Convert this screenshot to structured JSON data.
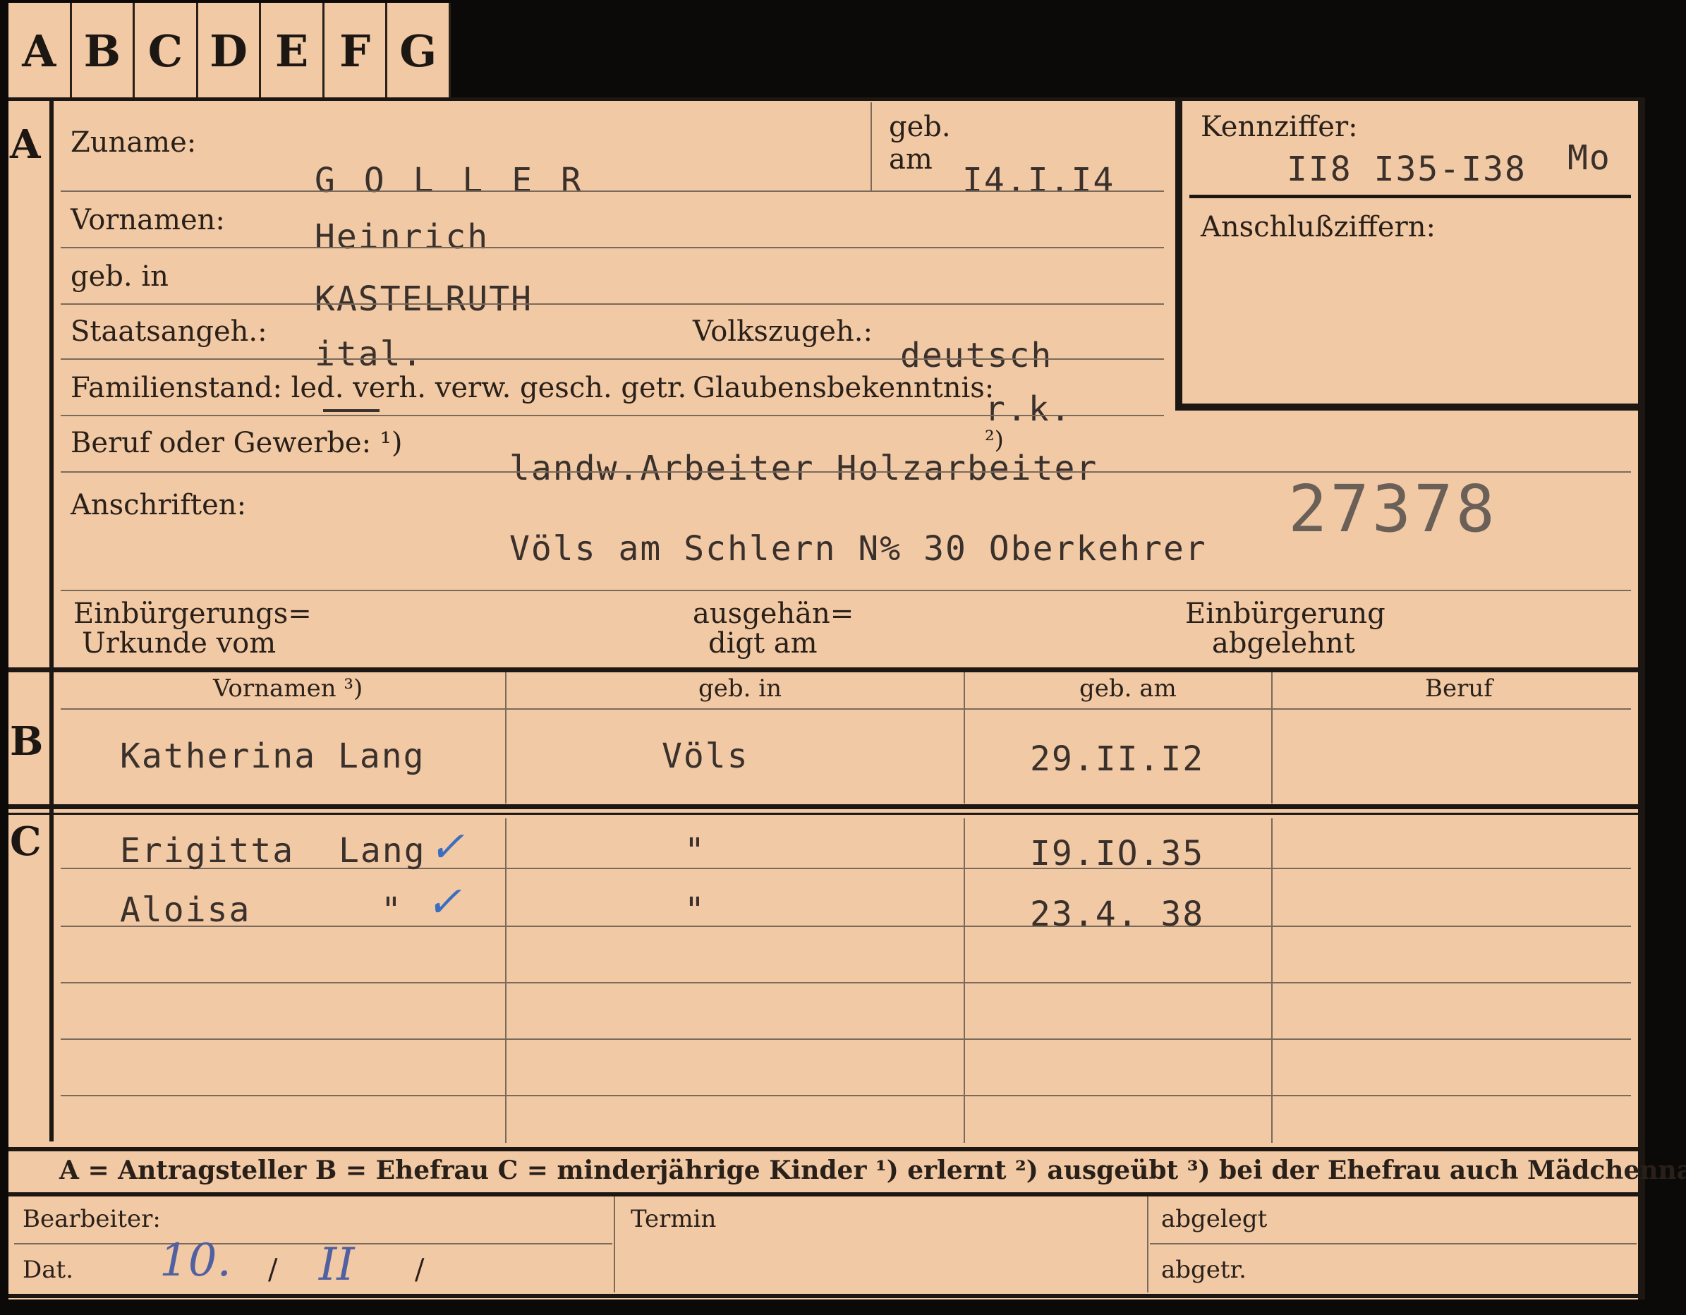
{
  "tabs": [
    "A",
    "B",
    "C",
    "D",
    "E",
    "F",
    "G"
  ],
  "sections": {
    "a": "A",
    "b": "B",
    "c": "C"
  },
  "labels": {
    "zuname": "Zuname:",
    "geb_am_1": "geb.",
    "geb_am_2": "am",
    "kennziffer": "Kennziffer:",
    "anschlussziffern": "Anschlußziffern:",
    "vornamen": "Vornamen:",
    "geb_in": "geb. in",
    "staatsangeh": "Staatsangeh.:",
    "volkszugeh": "Volkszugeh.:",
    "familienstand": "Familienstand: led. verh. verw. gesch. getr.",
    "glaubensbekenntnis": "Glaubensbekenntnis:",
    "beruf": "Beruf oder Gewerbe: ¹)",
    "beruf_note2": "²)",
    "anschriften": "Anschriften:",
    "einb_urkunde_1": "Einbürgerungs=",
    "einb_urkunde_2": "Urkunde vom",
    "ausgehaen_1": "ausgehän=",
    "ausgehaen_2": "digt am",
    "einb_abgelehnt_1": "Einbürgerung",
    "einb_abgelehnt_2": "abgelehnt",
    "col_vornamen": "Vornamen ³)",
    "col_geb_in": "geb. in",
    "col_geb_am": "geb. am",
    "col_beruf": "Beruf",
    "legend": "A = Antragsteller   B = Ehefrau   C = minderjährige Kinder   ¹) erlernt   ²) ausgeübt   ³) bei der Ehefrau auch Mädchenname",
    "bearbeiter": "Bearbeiter:",
    "termin": "Termin",
    "abgelegt": "abgelegt",
    "dat": "Dat.",
    "abgetr": "abgetr."
  },
  "values": {
    "zuname": "G O L L E R",
    "geb_am": "I4.I.I4",
    "kennziffer": "II8 I35-I38",
    "kennziffer_suffix": "Mo",
    "vornamen": "Heinrich",
    "geb_in": "KASTELRUTH",
    "staatsangeh": "ital.",
    "volkszugeh": "deutsch",
    "glaubensbekenntnis": "r.k.",
    "beruf": "landw.Arbeiter Holzarbeiter",
    "anschrift": "Völs am Schlern N% 30 Oberkehrer",
    "card_number": "27378"
  },
  "spouse": {
    "vornamen": "Katherina Lang",
    "geb_in": "Völs",
    "geb_am": "29.II.I2",
    "beruf": ""
  },
  "children": [
    {
      "vornamen": "Erigitta",
      "surname": "Lang",
      "geb_in": "\"",
      "geb_am": "I9.IO.35"
    },
    {
      "vornamen": "Aloisa",
      "surname": "\"",
      "geb_in": "\"",
      "geb_am": "23.4. 38"
    }
  ],
  "footer": {
    "dat_day": "10.",
    "dat_sep1": "/",
    "dat_month": "II",
    "dat_sep2": "/"
  }
}
